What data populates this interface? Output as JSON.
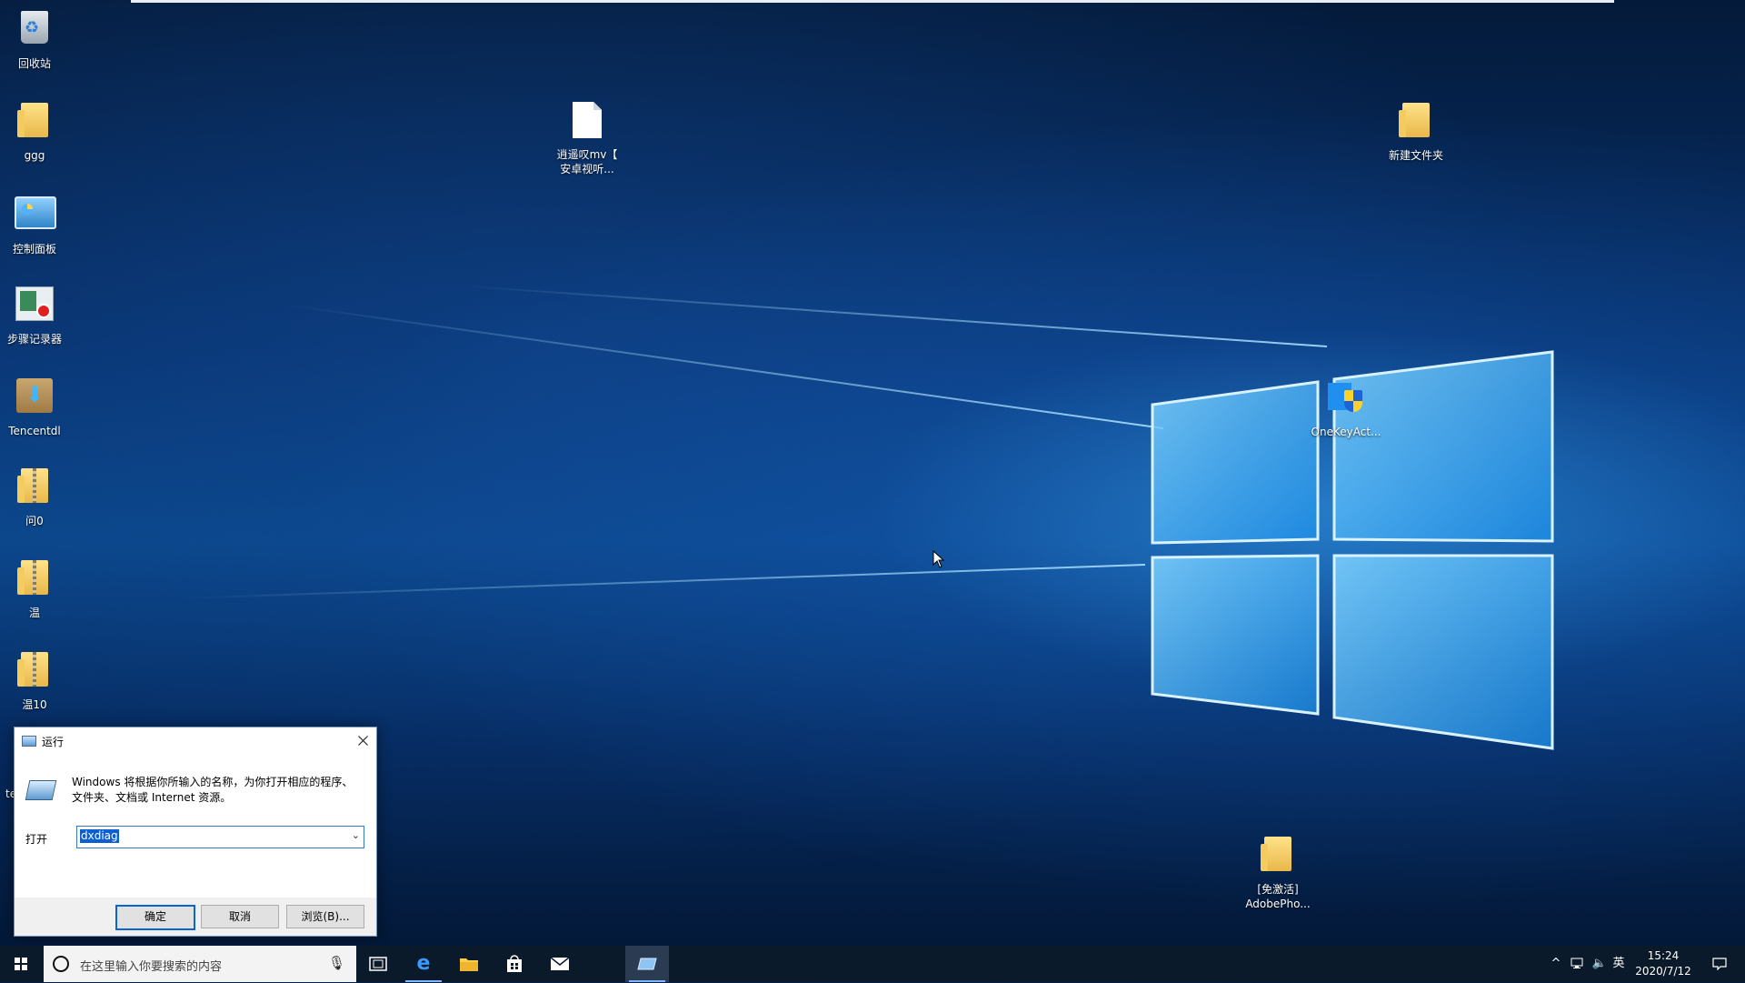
{
  "desktop": {
    "left_icons": [
      {
        "label": "回收站",
        "icon": "recycle-bin-icon"
      },
      {
        "label": "ggg",
        "icon": "user-folder-icon"
      },
      {
        "label": "控制面板",
        "icon": "control-panel-icon"
      },
      {
        "label": "步骤记录器",
        "icon": "steps-recorder-icon"
      },
      {
        "label": "Tencentdl",
        "icon": "tencent-download-icon"
      },
      {
        "label": "问0",
        "icon": "zip-folder-icon"
      },
      {
        "label": "温",
        "icon": "zip-folder-icon"
      },
      {
        "label": "温10",
        "icon": "zip-folder-icon"
      }
    ],
    "file_icon": {
      "label_line1": "逍遥叹mv【",
      "label_line2": "安卓视听...",
      "icon": "document-icon"
    },
    "new_folder": {
      "label": "新建文件夹",
      "icon": "folder-icon"
    },
    "onekey": {
      "label": "OneKeyAct...",
      "icon": "shield-icon"
    },
    "adobe": {
      "label_line1": "[免激活]",
      "label_line2": "AdobePho...",
      "icon": "folder-icon"
    },
    "partial_label": "te"
  },
  "run_dialog": {
    "title": "运行",
    "description": "Windows 将根据你所输入的名称，为你打开相应的程序、文件夹、文档或 Internet 资源。",
    "open_label": "打开",
    "input_value": "dxdiag",
    "ok": "确定",
    "cancel": "取消",
    "browse": "浏览(B)..."
  },
  "taskbar": {
    "search_placeholder": "在这里输入你要搜索的内容",
    "apps": [
      "task-view-icon",
      "edge-icon",
      "file-explorer-icon",
      "store-icon",
      "mail-icon",
      "run-icon"
    ],
    "tray": {
      "chevron": "^",
      "ime": "英"
    },
    "time": "15:24",
    "date": "2020/7/12"
  },
  "colors": {
    "desktop_dark": "#041a3a",
    "desktop_glow": "#3aaaff",
    "taskbar": "#0b1a2b",
    "dialog_accent": "#0a64d6"
  }
}
